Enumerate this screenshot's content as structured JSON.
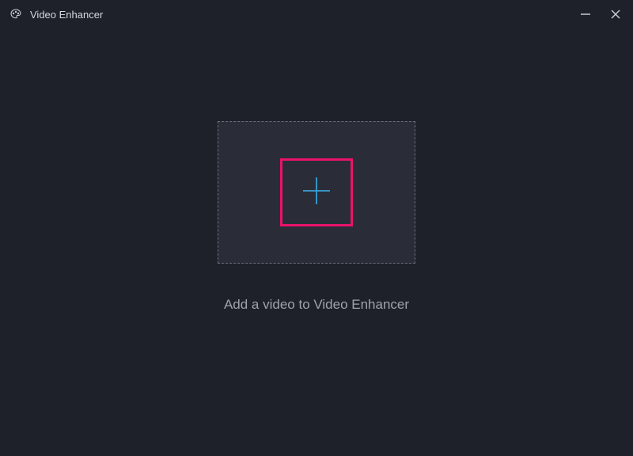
{
  "window": {
    "title": "Video Enhancer"
  },
  "main": {
    "caption": "Add a video to Video Enhancer"
  },
  "colors": {
    "accent_plus": "#3aa0d6",
    "highlight_border": "#e9136b"
  }
}
